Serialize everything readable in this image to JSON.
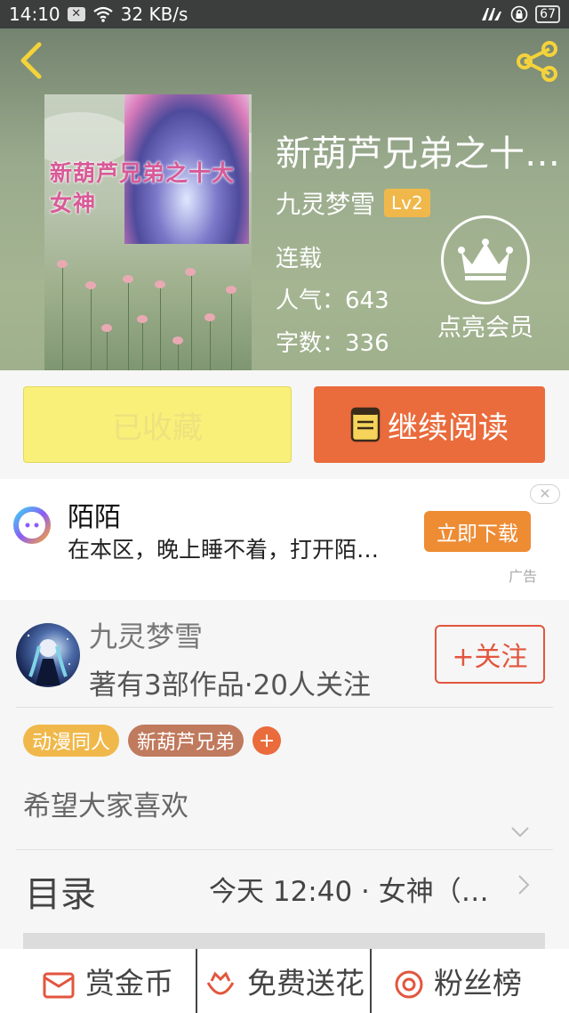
{
  "status_bar": {
    "time": "14:10",
    "speed": "32 KB/s",
    "battery": "67"
  },
  "book": {
    "title": "新葫芦兄弟之十…",
    "cover_title": "新葫芦兄弟之十大女神",
    "author": "九灵梦雪",
    "level": "Lv2",
    "status": "连载",
    "popularity": "人气：643",
    "word_count": "字数：336"
  },
  "vip": {
    "label": "点亮会员"
  },
  "actions": {
    "collect_label": "已收藏",
    "read_label": "继续阅读"
  },
  "ad": {
    "title": "陌陌",
    "desc": "在本区，晚上睡不着，打开陌…",
    "download_label": "立即下载",
    "tag": "广告"
  },
  "author": {
    "name": "九灵梦雪",
    "works": "著有3部作品·20人关注",
    "follow_label": "+关注"
  },
  "tags": [
    {
      "label": "动漫同人",
      "color": "#f0b84a"
    },
    {
      "label": "新葫芦兄弟",
      "color": "#c07a5e"
    }
  ],
  "tag_add": "+",
  "description": "希望大家喜欢",
  "toc": {
    "label": "目录",
    "latest": "今天 12:40 · 女神（…"
  },
  "bottom_bar": {
    "reward": "赏金币",
    "flowers": "免费送花",
    "fans": "粉丝榜"
  },
  "colors": {
    "accent": "#ea6b3c",
    "collect_bg": "#f9f07a",
    "follow": "#e2563e",
    "download": "#ee8c34"
  }
}
